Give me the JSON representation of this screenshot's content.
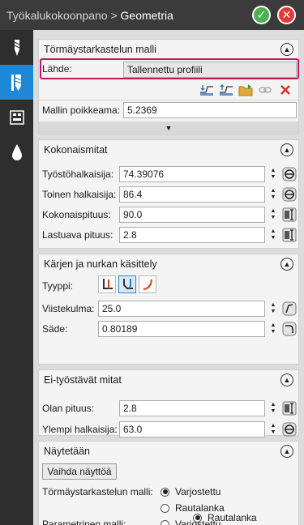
{
  "header": {
    "breadcrumb_parent": "Työkalukokoonpano",
    "separator": ">",
    "title": "Geometria"
  },
  "sidebar": {
    "items": [
      {
        "icon": "drill-tool-icon",
        "active": false
      },
      {
        "icon": "drill-holder-icon",
        "active": true
      },
      {
        "icon": "assembly-icon",
        "active": false
      },
      {
        "icon": "coolant-drop-icon",
        "active": false
      }
    ]
  },
  "collision": {
    "title": "Törmäystarkastelun malli",
    "source_label": "Lähde:",
    "source_value": "Tallennettu profiili",
    "offset_label": "Mallin poikkeama:",
    "offset_value": "5.2369"
  },
  "overall": {
    "title": "Kokonaismitat",
    "rows": [
      {
        "label": "Työstöhalkaisija:",
        "value": "74.39076"
      },
      {
        "label": "Toinen halkaisija:",
        "value": "86.4"
      },
      {
        "label": "Kokonaispituus:",
        "value": "90.0"
      },
      {
        "label": "Lastuava pituus:",
        "value": "2.8"
      }
    ]
  },
  "edge": {
    "title": "Kärjen ja nurkan käsittely",
    "type_label": "Tyyppi:",
    "angle_label": "Viistekulma:",
    "angle_value": "25.0",
    "radius_label": "Säde:",
    "radius_value": "0.80189"
  },
  "noncut": {
    "title": "Ei-työstävät mitat",
    "rows": [
      {
        "label": "Olan pituus:",
        "value": "2.8"
      },
      {
        "label": "Ylempi halkaisija:",
        "value": "63.0"
      }
    ]
  },
  "display": {
    "title": "Näytetään",
    "switch_button": "Vaihda näyttöä",
    "collision_label": "Törmäystarkastelun malli:",
    "parametric_label": "Parametrinen malli:",
    "opt_shaded": "Varjostettu",
    "opt_wire": "Rautalanka"
  }
}
